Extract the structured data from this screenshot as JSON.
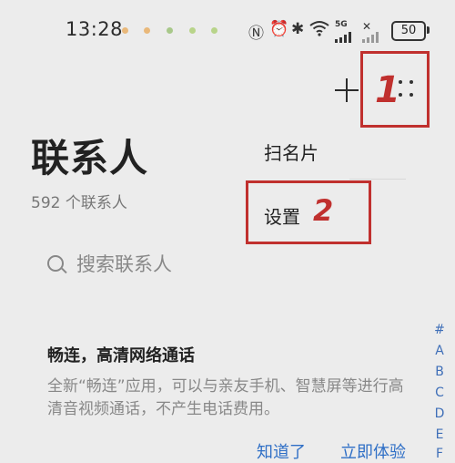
{
  "status_bar": {
    "time": "13:28",
    "notification_dot_colors": [
      "#e9b87a",
      "#e9b87a",
      "#a8c88a",
      "#b8d48a"
    ],
    "signal_label": "5G",
    "battery": "50"
  },
  "toolbar": {
    "add_icon": "plus-icon",
    "more_icon": "more-dots-icon",
    "annotation_1": "1"
  },
  "header": {
    "title": "联系人",
    "count": "592 个联系人"
  },
  "menu": {
    "items": [
      "扫名片",
      "设置"
    ],
    "annotation_2": "2"
  },
  "search": {
    "placeholder": "搜索联系人"
  },
  "promo": {
    "title": "畅连，高清网络通话",
    "body": "全新“畅连”应用，可以与亲友手机、智慧屏等进行高清音视频通话，不产生电话费用。",
    "dismiss": "知道了",
    "try": "立即体验"
  },
  "index_bar": [
    "#",
    "A",
    "B",
    "C",
    "D",
    "E",
    "F"
  ],
  "colors": {
    "accent": "#2f6fc6",
    "annotation": "#c0302e",
    "background": "#ececec"
  }
}
